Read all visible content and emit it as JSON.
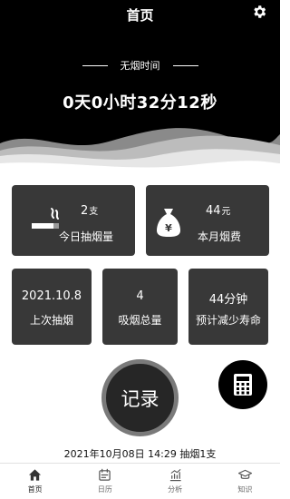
{
  "header": {
    "title": "首页",
    "settings_icon": "gear-icon"
  },
  "hero": {
    "subtitle": "无烟时间",
    "timer": "0天0小时32分12秒"
  },
  "stats_top": [
    {
      "value": "2",
      "unit": "支",
      "label": "今日抽烟量",
      "icon": "cigarette-icon"
    },
    {
      "value": "44",
      "unit": "元",
      "label": "本月烟费",
      "icon": "money-bag-icon"
    }
  ],
  "stats_bottom": [
    {
      "value": "2021.10.8",
      "label": "上次抽烟"
    },
    {
      "value": "4",
      "label": "吸烟总量"
    },
    {
      "value": "44分钟",
      "label": "预计减少寿命"
    }
  ],
  "record_button": {
    "label": "记录"
  },
  "calculator_button": {
    "icon": "calculator-icon"
  },
  "log_entry": "2021年10月08日 14:29  抽烟1支",
  "tabs": [
    {
      "label": "首页",
      "icon": "home-icon",
      "active": true
    },
    {
      "label": "日历",
      "icon": "calendar-icon",
      "active": false
    },
    {
      "label": "分析",
      "icon": "chart-icon",
      "active": false
    },
    {
      "label": "知识",
      "icon": "graduation-cap-icon",
      "active": false
    }
  ],
  "colors": {
    "hero_bg": "#000000",
    "card_bg": "#383838",
    "accent": "#000000"
  }
}
